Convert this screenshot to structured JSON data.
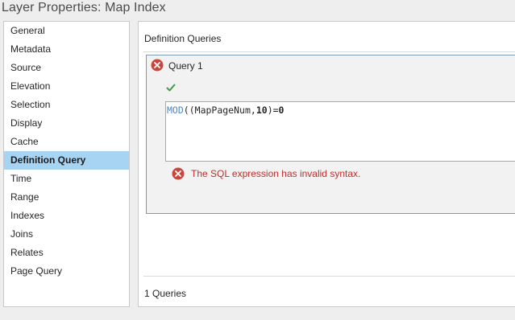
{
  "window": {
    "title": "Layer Properties: Map Index"
  },
  "sidebar": {
    "items": [
      {
        "label": "General"
      },
      {
        "label": "Metadata"
      },
      {
        "label": "Source"
      },
      {
        "label": "Elevation"
      },
      {
        "label": "Selection"
      },
      {
        "label": "Display"
      },
      {
        "label": "Cache"
      },
      {
        "label": "Definition Query",
        "selected": true
      },
      {
        "label": "Time"
      },
      {
        "label": "Range"
      },
      {
        "label": "Indexes"
      },
      {
        "label": "Joins"
      },
      {
        "label": "Relates"
      },
      {
        "label": "Page Query"
      }
    ]
  },
  "main": {
    "heading": "Definition Queries",
    "query": {
      "title": "Query 1",
      "expression_parts": {
        "func": "MOD",
        "open": "((",
        "field": "MapPageNum",
        "comma": ",",
        "arg": "10",
        "close": ")=",
        "value": "0"
      },
      "error_message": "The SQL expression has invalid syntax."
    },
    "query_count": "1 Queries"
  },
  "icons": {
    "query_error": "error-circle-x-icon",
    "validate": "checkmark-icon",
    "message_error": "error-circle-x-icon"
  },
  "colors": {
    "selected_bg": "#a8d4f4",
    "error_red": "#c9463d",
    "check_green": "#3e9e46",
    "error_text": "#b8312f",
    "keyword_blue": "#4a89c8"
  }
}
